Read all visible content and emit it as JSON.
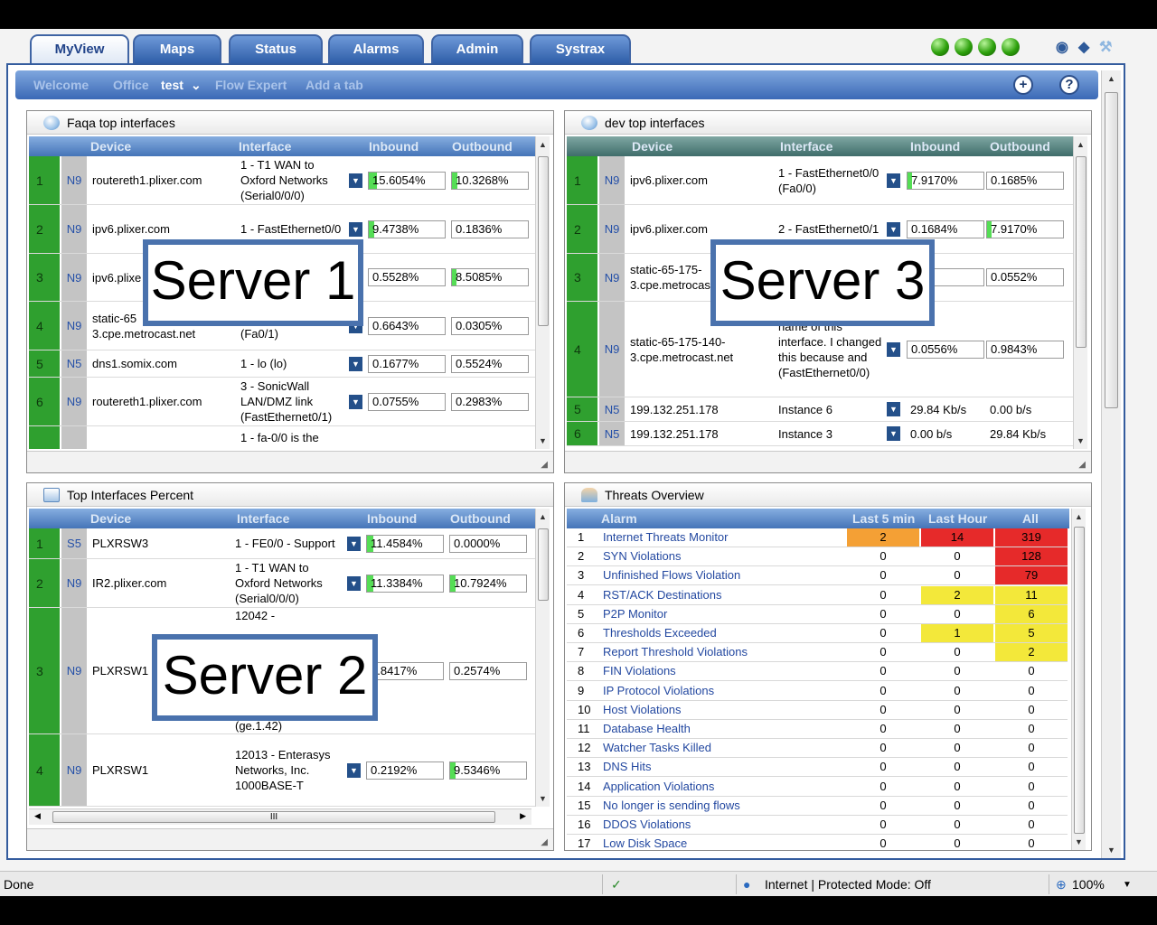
{
  "tabs": [
    "MyView",
    "Maps",
    "Status",
    "Alarms",
    "Admin",
    "Systrax"
  ],
  "subnav": {
    "welcome": "Welcome",
    "office": "Office",
    "test": "test",
    "flow_expert": "Flow Expert",
    "add_tab": "Add a tab",
    "add_symbol": "+",
    "help_symbol": "?"
  },
  "columns": {
    "device": "Device",
    "interface": "Interface",
    "inbound": "Inbound",
    "outbound": "Outbound"
  },
  "panels": {
    "faqa": {
      "title": "Faqa top interfaces",
      "rows": [
        {
          "rank": "1",
          "level": "N9",
          "device": "routereth1.plixer.com",
          "iface": "1 - T1 WAN to Oxford Networks (Serial0/0/0)",
          "inbound": "15.6054%",
          "outbound": "10.3268%",
          "in_pct": 15.6,
          "out_pct": 10.3
        },
        {
          "rank": "2",
          "level": "N9",
          "device": "ipv6.plixer.com",
          "iface": "1 - FastEthernet0/0",
          "inbound": "9.4738%",
          "outbound": "0.1836%",
          "in_pct": 9.5,
          "out_pct": 0
        },
        {
          "rank": "3",
          "level": "N9",
          "device": "ipv6.plixe",
          "iface": "",
          "inbound": "0.5528%",
          "outbound": "8.5085%",
          "in_pct": 0,
          "out_pct": 8.5
        },
        {
          "rank": "4",
          "level": "N9",
          "device": "static-65 3.cpe.metrocast.net",
          "iface": "FastEthernet0/1 (Fa0/1)",
          "inbound": "0.6643%",
          "outbound": "0.0305%",
          "in_pct": 0,
          "out_pct": 0
        },
        {
          "rank": "5",
          "level": "N5",
          "device": "dns1.somix.com",
          "iface": "1 - lo (lo)",
          "inbound": "0.1677%",
          "outbound": "0.5524%",
          "in_pct": 0,
          "out_pct": 0
        },
        {
          "rank": "6",
          "level": "N9",
          "device": "routereth1.plixer.com",
          "iface": "3 - SonicWall LAN/DMZ link (FastEthernet0/1)",
          "inbound": "0.0755%",
          "outbound": "0.2983%",
          "in_pct": 0,
          "out_pct": 0
        },
        {
          "rank": "",
          "level": "",
          "device": "",
          "iface": "1 - fa-0/0 is the",
          "inbound": "",
          "outbound": "",
          "in_pct": 0,
          "out_pct": 0
        }
      ]
    },
    "dev": {
      "title": "dev top interfaces",
      "rows": [
        {
          "rank": "1",
          "level": "N9",
          "device": "ipv6.plixer.com",
          "iface": "1 - FastEthernet0/0 (Fa0/0)",
          "inbound": "7.9170%",
          "outbound": "0.1685%",
          "in_pct": 7.9,
          "out_pct": 0
        },
        {
          "rank": "2",
          "level": "N9",
          "device": "ipv6.plixer.com",
          "iface": "2 - FastEthernet0/1",
          "inbound": "0.1684%",
          "outbound": "7.9170%",
          "in_pct": 0,
          "out_pct": 7.9
        },
        {
          "rank": "3",
          "level": "N9",
          "device": "static-65-175- 3.cpe.metrocas",
          "iface": "",
          "inbound": "43%",
          "outbound": "0.0552%",
          "in_pct": 0,
          "out_pct": 0
        },
        {
          "rank": "4",
          "level": "N9",
          "device": "static-65-175-140- 3.cpe.metrocast.net",
          "iface": "name of this interface. I changed this because and (FastEthernet0/0)",
          "inbound": "0.0556%",
          "outbound": "0.9843%",
          "in_pct": 0,
          "out_pct": 0
        },
        {
          "rank": "5",
          "level": "N5",
          "device": "199.132.251.178",
          "iface": "Instance 6",
          "inbound": "29.84 Kb/s",
          "outbound": "0.00 b/s",
          "in_pct": 0,
          "out_pct": 0
        },
        {
          "rank": "6",
          "level": "N5",
          "device": "199.132.251.178",
          "iface": "Instance 3",
          "inbound": "0.00 b/s",
          "outbound": "29.84 Kb/s",
          "in_pct": 0,
          "out_pct": 0
        }
      ]
    },
    "top_pct": {
      "title": "Top Interfaces Percent",
      "hscroll_label": "III",
      "rows": [
        {
          "rank": "1",
          "level": "S5",
          "device": "PLXRSW3",
          "iface": "1 - FE0/0 - Support",
          "inbound": "11.4584%",
          "outbound": "0.0000%",
          "in_pct": 11.5,
          "out_pct": 0
        },
        {
          "rank": "2",
          "level": "N9",
          "device": "IR2.plixer.com",
          "iface": "1 - T1 WAN to Oxford Networks (Serial0/0/0)",
          "inbound": "11.3384%",
          "outbound": "10.7924%",
          "in_pct": 11.3,
          "out_pct": 10.8
        },
        {
          "rank": "3",
          "level": "N9",
          "device": "PLXRSW1",
          "iface_top": "12042 -",
          "iface_bottom": "(ge.1.42)",
          "inbound": "0.8417%",
          "outbound": "0.2574%",
          "in_pct": 0,
          "out_pct": 0
        },
        {
          "rank": "4",
          "level": "N9",
          "device": "PLXRSW1",
          "iface": "12013 - Enterasys Networks, Inc. 1000BASE-T",
          "inbound": "0.2192%",
          "outbound": "9.5346%",
          "in_pct": 0,
          "out_pct": 9.5
        }
      ]
    },
    "threats": {
      "title": "Threats Overview",
      "headers": {
        "alarm": "Alarm",
        "last5": "Last 5 min",
        "last_hour": "Last Hour",
        "all": "All"
      },
      "rows": [
        {
          "n": "1",
          "name": "Internet Threats Monitor",
          "last5": "2",
          "hour": "14",
          "all": "319",
          "c5": "#f4a035",
          "ch": "#e62a2a",
          "ca": "#e62a2a"
        },
        {
          "n": "2",
          "name": "SYN Violations",
          "last5": "0",
          "hour": "0",
          "all": "128",
          "c5": "",
          "ch": "",
          "ca": "#e62a2a"
        },
        {
          "n": "3",
          "name": "Unfinished Flows Violation",
          "last5": "0",
          "hour": "0",
          "all": "79",
          "c5": "",
          "ch": "",
          "ca": "#e62a2a"
        },
        {
          "n": "4",
          "name": "RST/ACK Destinations",
          "last5": "0",
          "hour": "2",
          "all": "11",
          "c5": "",
          "ch": "#f3e83a",
          "ca": "#f3e83a"
        },
        {
          "n": "5",
          "name": "P2P Monitor",
          "last5": "0",
          "hour": "0",
          "all": "6",
          "c5": "",
          "ch": "",
          "ca": "#f3e83a"
        },
        {
          "n": "6",
          "name": "Thresholds Exceeded",
          "last5": "0",
          "hour": "1",
          "all": "5",
          "c5": "",
          "ch": "#f3e83a",
          "ca": "#f3e83a"
        },
        {
          "n": "7",
          "name": "Report Threshold Violations",
          "last5": "0",
          "hour": "0",
          "all": "2",
          "c5": "",
          "ch": "",
          "ca": "#f3e83a"
        },
        {
          "n": "8",
          "name": "FIN Violations",
          "last5": "0",
          "hour": "0",
          "all": "0",
          "c5": "",
          "ch": "",
          "ca": ""
        },
        {
          "n": "9",
          "name": "IP Protocol Violations",
          "last5": "0",
          "hour": "0",
          "all": "0",
          "c5": "",
          "ch": "",
          "ca": ""
        },
        {
          "n": "10",
          "name": "Host Violations",
          "last5": "0",
          "hour": "0",
          "all": "0",
          "c5": "",
          "ch": "",
          "ca": ""
        },
        {
          "n": "11",
          "name": "Database Health",
          "last5": "0",
          "hour": "0",
          "all": "0",
          "c5": "",
          "ch": "",
          "ca": ""
        },
        {
          "n": "12",
          "name": "Watcher Tasks Killed",
          "last5": "0",
          "hour": "0",
          "all": "0",
          "c5": "",
          "ch": "",
          "ca": ""
        },
        {
          "n": "13",
          "name": "DNS Hits",
          "last5": "0",
          "hour": "0",
          "all": "0",
          "c5": "",
          "ch": "",
          "ca": ""
        },
        {
          "n": "14",
          "name": "Application Violations",
          "last5": "0",
          "hour": "0",
          "all": "0",
          "c5": "",
          "ch": "",
          "ca": ""
        },
        {
          "n": "15",
          "name": "No longer is sending flows",
          "last5": "0",
          "hour": "0",
          "all": "0",
          "c5": "",
          "ch": "",
          "ca": ""
        },
        {
          "n": "16",
          "name": "DDOS Violations",
          "last5": "0",
          "hour": "0",
          "all": "0",
          "c5": "",
          "ch": "",
          "ca": ""
        },
        {
          "n": "17",
          "name": "Low Disk Space",
          "last5": "0",
          "hour": "0",
          "all": "0",
          "c5": "",
          "ch": "",
          "ca": ""
        }
      ]
    }
  },
  "overlays": {
    "server1": "Server 1",
    "server2": "Server 2",
    "server3": "Server 3"
  },
  "statusbar": {
    "done": "Done",
    "zone": "Internet | Protected Mode: Off",
    "zoom": "100%"
  }
}
